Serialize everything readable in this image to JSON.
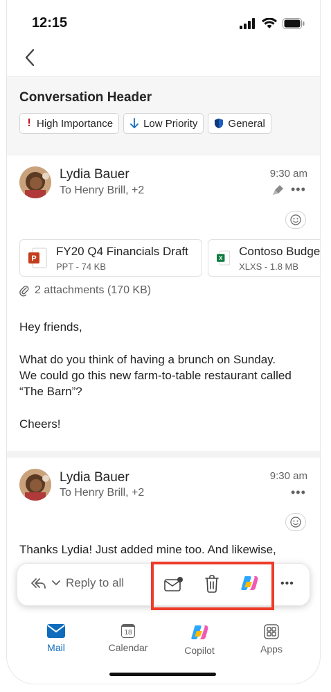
{
  "status_bar": {
    "time": "12:15"
  },
  "conversation": {
    "title": "Conversation Header",
    "chips": [
      {
        "label": "High Importance",
        "icon": "exclamation-icon",
        "color": "#c50f1f"
      },
      {
        "label": "Low Priority",
        "icon": "arrow-down-icon",
        "color": "#0f6cbd"
      },
      {
        "label": "General",
        "icon": "shield-icon",
        "color": "#0f3a7a"
      }
    ]
  },
  "messages": [
    {
      "sender": "Lydia Bauer",
      "to": "To Henry Brill, +2",
      "time": "9:30 am",
      "attachments": [
        {
          "name": "FY20 Q4 Financials Draft",
          "meta": "PPT - 74 KB",
          "type": "ppt"
        },
        {
          "name": "Contoso Budget",
          "meta": "XLXS - 1.8 MB",
          "type": "xlsx"
        }
      ],
      "attachments_summary": "2 attachments (170 KB)",
      "body": [
        "Hey friends,",
        "What do you think of having a brunch on Sunday. We could go this new farm-to-table restaurant called “The Barn”?",
        "Cheers!"
      ]
    },
    {
      "sender": "Lydia Bauer",
      "to": "To Henry Brill, +2",
      "time": "9:30 am",
      "body": [
        "Thanks Lydia! Just added mine too. And likewise,"
      ]
    }
  ],
  "reply_bar": {
    "reply_label": "Reply to all"
  },
  "bottom_nav": {
    "tabs": [
      {
        "label": "Mail",
        "active": true
      },
      {
        "label": "Calendar",
        "active": false
      },
      {
        "label": "Copilot",
        "active": false
      },
      {
        "label": "Apps",
        "active": false
      }
    ],
    "calendar_day": "18"
  },
  "colors": {
    "accent": "#0f6cbd",
    "highlight": "#ee3b2a"
  }
}
